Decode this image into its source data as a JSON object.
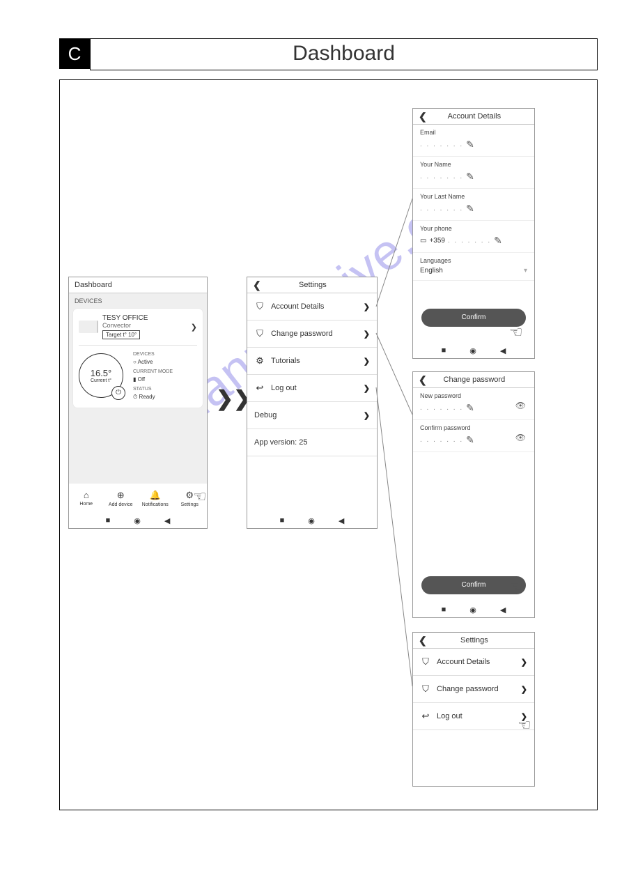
{
  "header": {
    "badge": "C",
    "title": "Dashboard"
  },
  "watermark": "manualshive.com",
  "dashboard": {
    "title": "Dashboard",
    "section_label": "DEVICES",
    "device": {
      "name": "TESY OFFICE",
      "subtitle": "Convector",
      "target_label": "Target t° 10°",
      "temp": "16.5°",
      "temp_label": "Current t°",
      "status_devices_label": "DEVICES",
      "status_devices_value": "Active",
      "status_mode_label": "CURRENT MODE",
      "status_mode_value": "Off",
      "status_status_label": "STATUS",
      "status_status_value": "Ready"
    },
    "nav": {
      "home": "Home",
      "add_device": "Add device",
      "notifications": "Notifications",
      "settings": "Settings"
    }
  },
  "settings": {
    "title": "Settings",
    "items": {
      "account_details": "Account Details",
      "change_password": "Change password",
      "tutorials": "Tutorials",
      "log_out": "Log out",
      "debug": "Debug",
      "app_version": "App version: 25"
    }
  },
  "account_details": {
    "title": "Account Details",
    "email_label": "Email",
    "name_label": "Your Name",
    "last_name_label": "Your Last Name",
    "phone_label": "Your phone",
    "phone_prefix": "+359",
    "languages_label": "Languages",
    "language_value": "English",
    "confirm": "Confirm"
  },
  "change_password": {
    "title": "Change password",
    "new_password_label": "New password",
    "confirm_password_label": "Confirm password",
    "confirm": "Confirm"
  },
  "settings2": {
    "title": "Settings",
    "account_details": "Account Details",
    "change_password": "Change password",
    "log_out": "Log out"
  },
  "dots_placeholder": ". . . . . . ."
}
